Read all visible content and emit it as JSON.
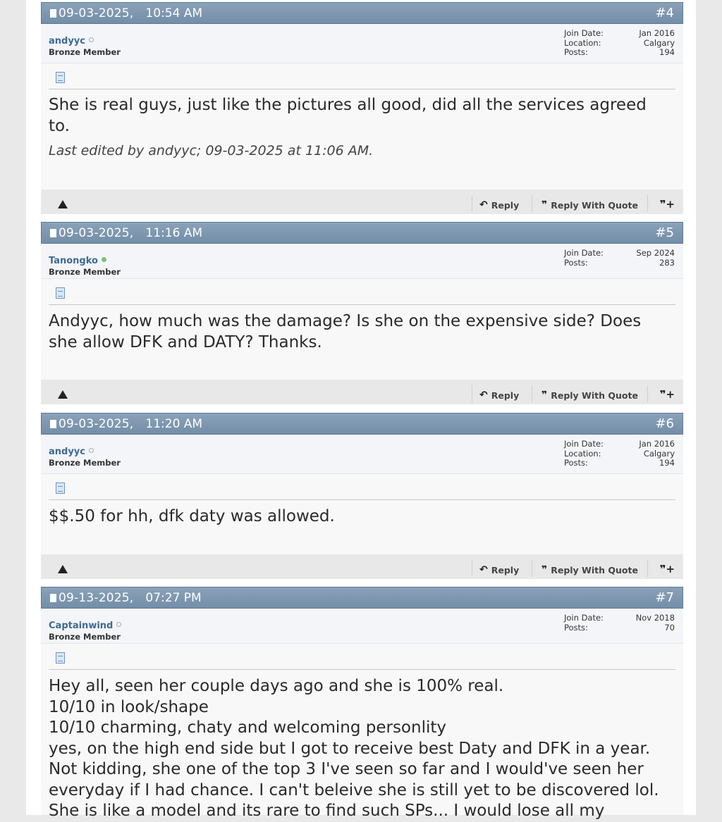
{
  "posts": [
    {
      "date": "09-03-2025,",
      "time": "10:54 AM",
      "num": "#4",
      "username": "andyyc",
      "online": false,
      "usertitle": "Bronze Member",
      "info": [
        {
          "k": "Join Date:",
          "v": "Jan 2016"
        },
        {
          "k": "Location:",
          "v": "Calgary"
        },
        {
          "k": "Posts:",
          "v": "194"
        }
      ],
      "message": "She is real guys, just like the pictures all good, did all the services agreed\nto.",
      "edited": "Last edited by andyyc; 09-03-2025 at 11:06 AM."
    },
    {
      "date": "09-03-2025,",
      "time": "11:16 AM",
      "num": "#5",
      "username": "Tanongko",
      "online": true,
      "usertitle": "Bronze Member",
      "info": [
        {
          "k": "Join Date:",
          "v": "Sep 2024"
        },
        {
          "k": "Posts:",
          "v": "283"
        }
      ],
      "message": "Andyyc, how much was the damage? Is she on the expensive side? Does\nshe allow DFK and DATY? Thanks.",
      "edited": ""
    },
    {
      "date": "09-03-2025,",
      "time": "11:20 AM",
      "num": "#6",
      "username": "andyyc",
      "online": false,
      "usertitle": "Bronze Member",
      "info": [
        {
          "k": "Join Date:",
          "v": "Jan 2016"
        },
        {
          "k": "Location:",
          "v": "Calgary"
        },
        {
          "k": "Posts:",
          "v": "194"
        }
      ],
      "message": "$$.50 for hh, dfk daty was allowed.",
      "edited": ""
    },
    {
      "date": "09-13-2025,",
      "time": "07:27 PM",
      "num": "#7",
      "username": "Captainwind",
      "online": false,
      "usertitle": "Bronze Member",
      "info": [
        {
          "k": "Join Date:",
          "v": "Nov 2018"
        },
        {
          "k": "Posts:",
          "v": "70"
        }
      ],
      "message": "Hey all, seen her couple days ago and she is 100% real.\n10/10 in look/shape\n10/10 charming, chaty and welcoming personlity\nyes, on the high end side but I got to receive best Daty and DFK in a year.\nNot kidding, she one of the top 3 I've seen so far and I would've seen her\neveryday if I had chance. I can't beleive she is still yet to be discovered lol.\nShe is like a model and its rare to find such SPs... I would lose all my",
      "edited": ""
    }
  ],
  "footer": {
    "reply_label": "Reply",
    "reply_quote_label": "Reply With Quote"
  },
  "icons": {
    "reply": "reply-arrow-icon",
    "quote": "quote-bubble-icon",
    "multiquote": "multiquote-plus-icon",
    "report": "report-warning-icon"
  },
  "colors": {
    "header": "#7f98b0",
    "username": "#3e6a92",
    "online": "#7bc36a"
  }
}
